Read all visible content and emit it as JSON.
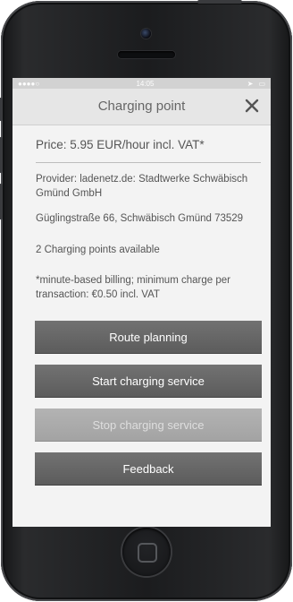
{
  "status_bar": {
    "carrier": "",
    "time": "14:05"
  },
  "nav": {
    "title": "Charging point",
    "close_icon": "close-icon"
  },
  "details": {
    "price": "Price: 5.95 EUR/hour incl. VAT*",
    "provider": "Provider: ladenetz.de: Stadtwerke Schwäbisch Gmünd GmbH",
    "address": "Güglingstraße 66, Schwäbisch Gmünd 73529",
    "availability": "2 Charging points available",
    "billing_note": "*minute-based billing; minimum charge per transaction: €0.50 incl. VAT"
  },
  "actions": {
    "route_planning": "Route planning",
    "start_charging": "Start charging service",
    "stop_charging": "Stop charging service",
    "feedback": "Feedback"
  },
  "colors": {
    "button": "#666666",
    "button_disabled": "#ababab",
    "text": "#555555"
  }
}
